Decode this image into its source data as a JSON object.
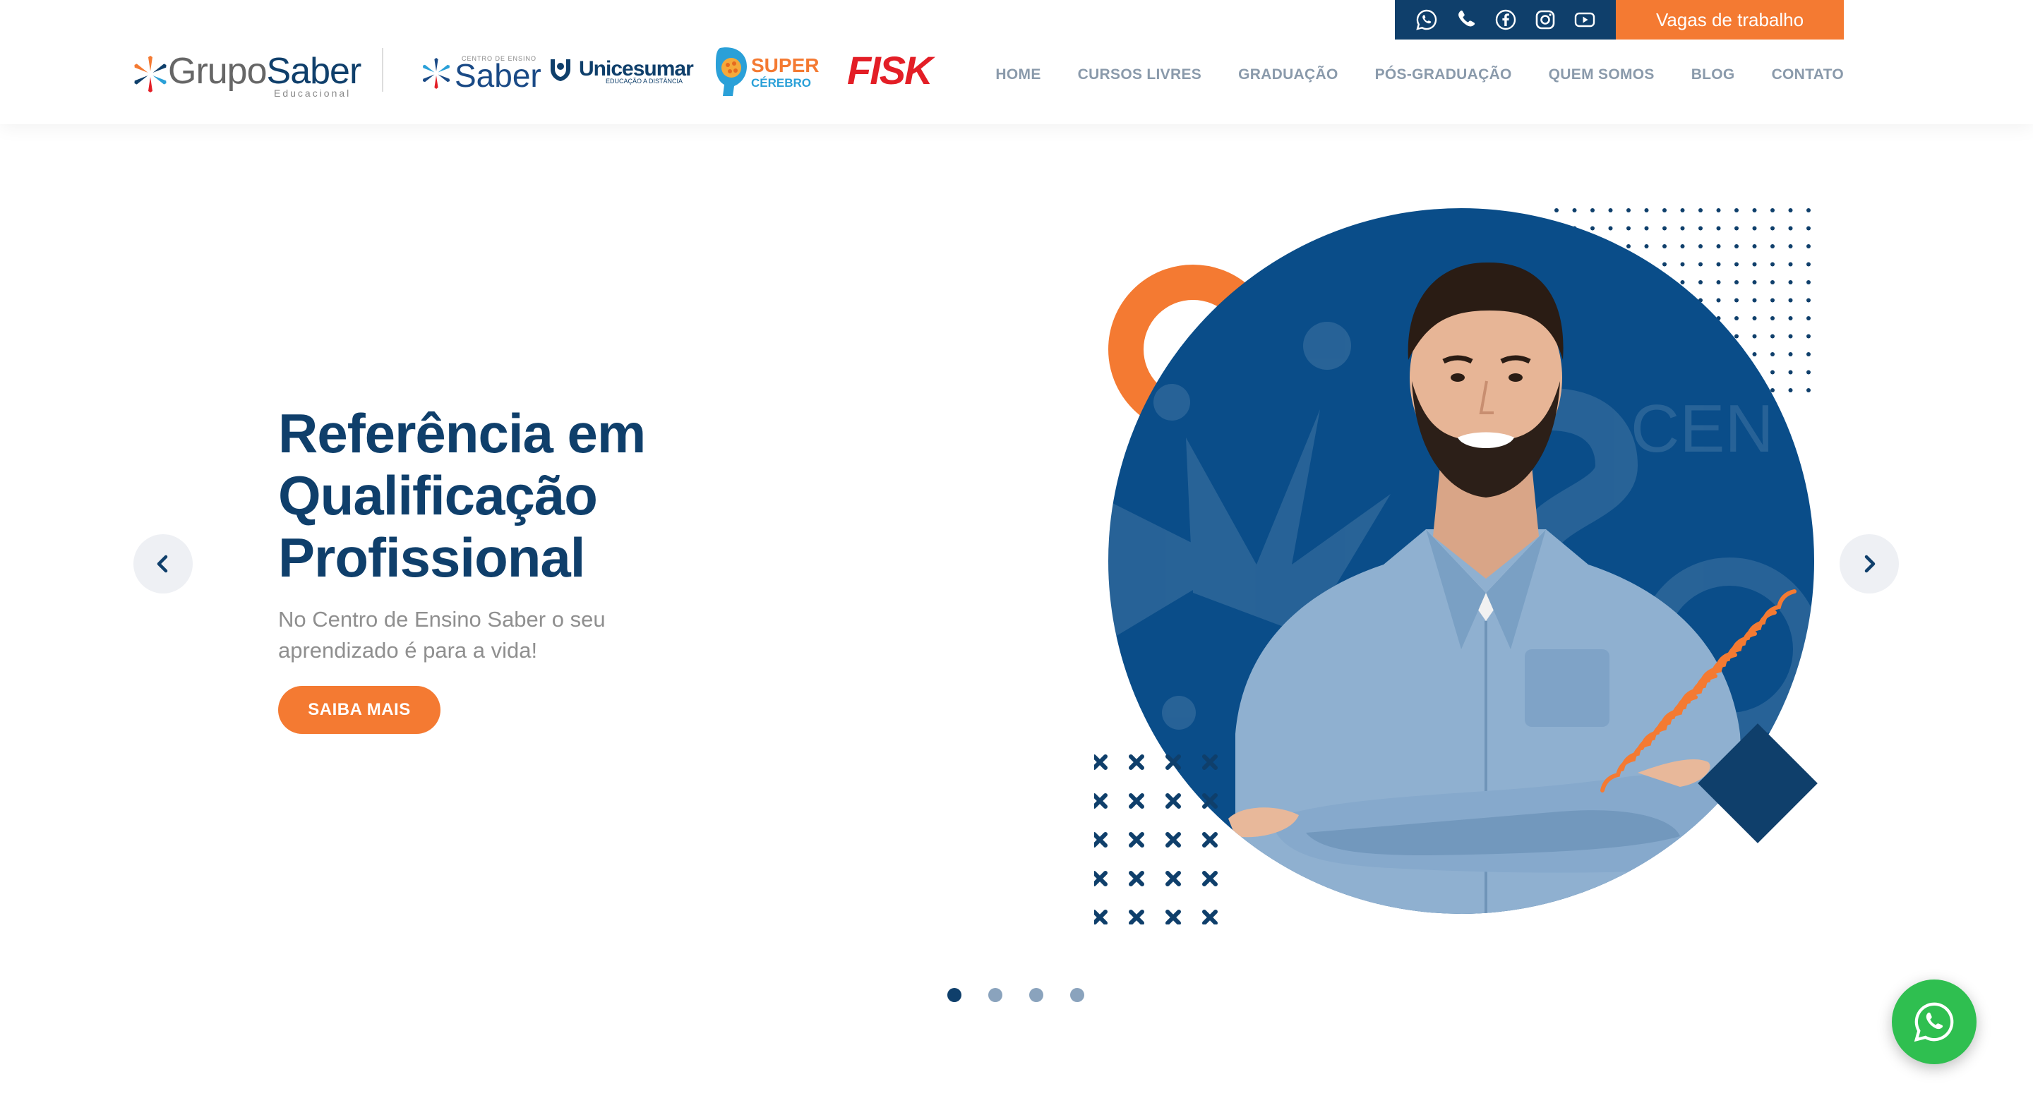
{
  "topbar": {
    "social_icons": [
      "whatsapp-icon",
      "phone-icon",
      "facebook-icon",
      "instagram-icon",
      "youtube-icon"
    ],
    "jobs_label": "Vagas de trabalho"
  },
  "brand": {
    "name_part1": "Grupo",
    "name_part2": "Saber",
    "tagline": "Educacional"
  },
  "partner_logos": {
    "saber_small": "CENTRO DE ENSINO",
    "saber_big": "Saber",
    "unicesumar": "Unicesumar",
    "unicesumar_sub": "EDUCAÇÃO A DISTÂNCIA",
    "super_1": "SUPER",
    "super_2": "CÉREBRO",
    "fisk": "FISK"
  },
  "nav": {
    "items": [
      "HOME",
      "CURSOS LIVRES",
      "GRADUAÇÃO",
      "PÓS-GRADUAÇÃO",
      "QUEM SOMOS",
      "BLOG",
      "CONTATO"
    ]
  },
  "hero": {
    "title_lines": [
      "Referência em",
      "Qualificação",
      "Profissional"
    ],
    "subtitle": "No Centro de Ensino Saber o seu aprendizado é para a vida!",
    "cta": "SAIBA MAIS",
    "bg_watermark": "CEN"
  },
  "carousel": {
    "slide_count": 4,
    "active_index": 0
  },
  "colors": {
    "navy": "#0f3f6b",
    "orange": "#f47a32",
    "whatsapp_green": "#2fbf50"
  }
}
